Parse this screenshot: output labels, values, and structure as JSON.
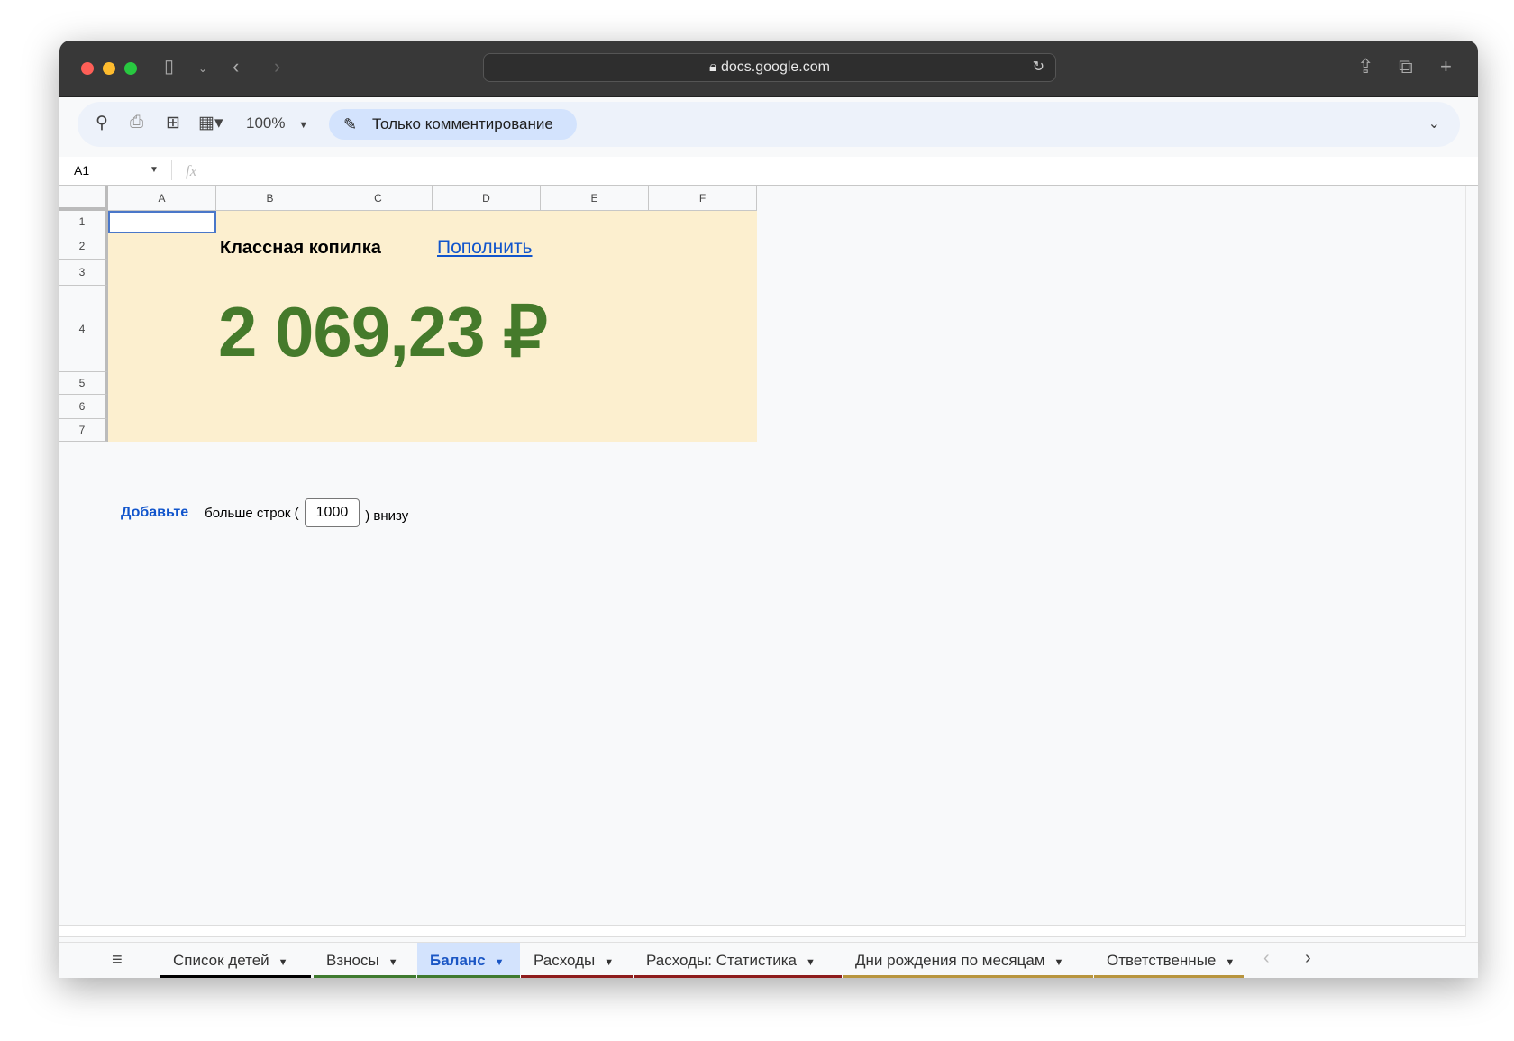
{
  "browser": {
    "url": "docs.google.com"
  },
  "toolbar": {
    "zoom": "100%",
    "mode": "Только комментирование"
  },
  "formula_bar": {
    "cell_ref": "A1",
    "fx": "fx",
    "value": ""
  },
  "columns": [
    "A",
    "B",
    "C",
    "D",
    "E",
    "F"
  ],
  "rows": [
    "1",
    "2",
    "3",
    "4",
    "5",
    "6",
    "7"
  ],
  "sheet": {
    "title": "Классная копилка",
    "link": "Пополнить",
    "amount": "2 069,23 ₽",
    "colors": {
      "fill": "#fcefcf",
      "amount": "#457a2b"
    }
  },
  "add_rows": {
    "link": "Добавьте",
    "text_before": "больше строк (",
    "count": "1000",
    "text_after": ") внизу"
  },
  "tabs": [
    {
      "label": "Список детей",
      "color": "#000000"
    },
    {
      "label": "Взносы",
      "color": "#3f7a2f"
    },
    {
      "label": "Баланс",
      "color": "#3f7a2f",
      "active": true
    },
    {
      "label": "Расходы",
      "color": "#8e1c1c"
    },
    {
      "label": "Расходы: Статистика",
      "color": "#8e1c1c"
    },
    {
      "label": "Дни рождения по месяцам",
      "color": "#b8953e"
    },
    {
      "label": "Ответственные",
      "color": "#b8953e"
    }
  ]
}
